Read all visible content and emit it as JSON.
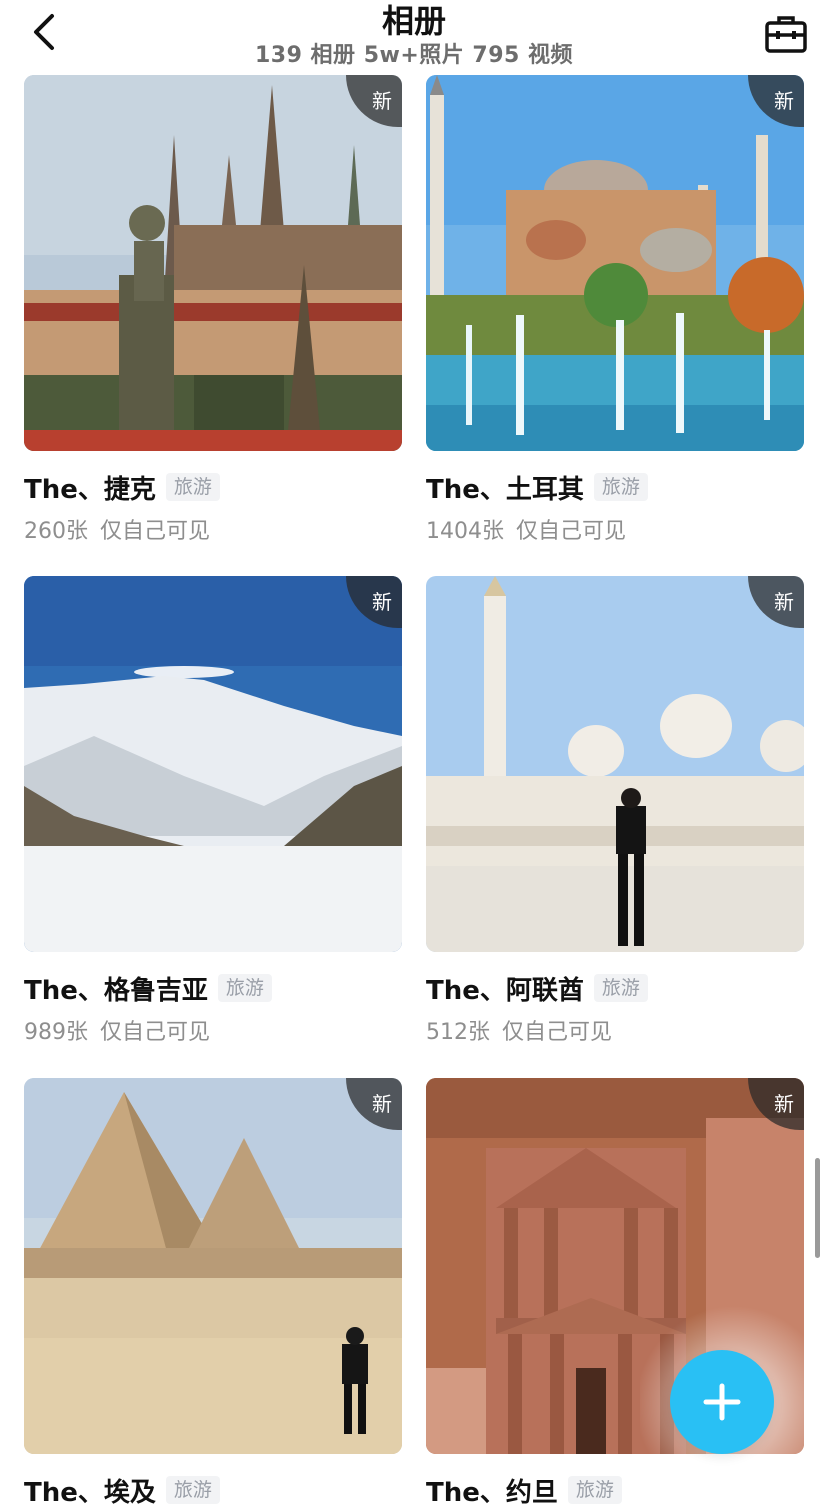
{
  "header": {
    "title": "相册",
    "subtitle": "139 相册 5w+照片 795 视频",
    "back_icon": "chevron-left-icon",
    "toolbox_icon": "toolbox-icon"
  },
  "new_badge_label": "新",
  "tag_label": "旅游",
  "visibility_label": "仅自己可见",
  "albums": [
    {
      "name": "The、捷克",
      "count": "260张",
      "scene": "prague-castle-statue"
    },
    {
      "name": "The、土耳其",
      "count": "1404张",
      "scene": "hagia-sophia-fountains"
    },
    {
      "name": "The、格鲁吉亚",
      "count": "989张",
      "scene": "snowy-mountains"
    },
    {
      "name": "The、阿联酋",
      "count": "512张",
      "scene": "white-mosque-person"
    },
    {
      "name": "The、埃及",
      "count": "",
      "scene": "pyramids-desert"
    },
    {
      "name": "The、约旦",
      "count": "",
      "scene": "petra-treasury"
    }
  ],
  "fab": {
    "icon": "plus-icon",
    "color": "#29c0f4"
  }
}
